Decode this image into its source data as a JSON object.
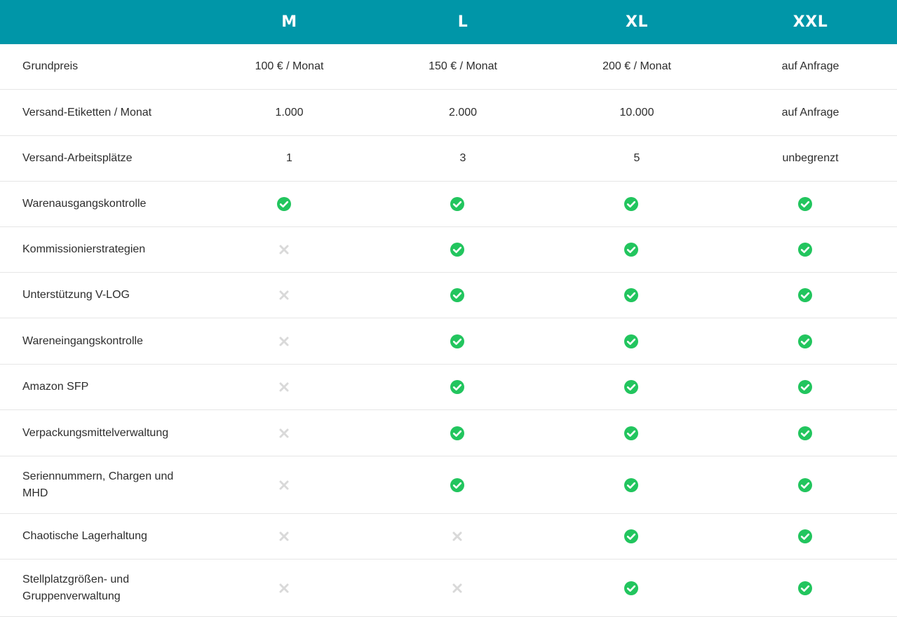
{
  "colors": {
    "header_bg": "#0096a8",
    "check": "#22c55e",
    "cross": "#d9d9d9"
  },
  "header": {
    "corner": "",
    "plans": [
      "M",
      "L",
      "XL",
      "XXL"
    ]
  },
  "rows": [
    {
      "label": "Grundpreis",
      "values": [
        "100 € / Monat",
        "150 € / Monat",
        "200 € / Monat",
        "auf Anfrage"
      ]
    },
    {
      "label": "Versand-Etiketten / Monat",
      "values": [
        "1.000",
        "2.000",
        "10.000",
        "auf Anfrage"
      ]
    },
    {
      "label": "Versand-Arbeitsplätze",
      "values": [
        "1",
        "3",
        "5",
        "unbegrenzt"
      ]
    },
    {
      "label": "Warenausgangskontrolle",
      "features": [
        "check-icon",
        "check-icon",
        "check-icon",
        "check-icon"
      ]
    },
    {
      "label": "Kommissionierstrategien",
      "features": [
        "cross-icon",
        "check-icon",
        "check-icon",
        "check-icon"
      ]
    },
    {
      "label": "Unterstützung V-LOG",
      "features": [
        "cross-icon",
        "check-icon",
        "check-icon",
        "check-icon"
      ]
    },
    {
      "label": "Wareneingangskontrolle",
      "features": [
        "cross-icon",
        "check-icon",
        "check-icon",
        "check-icon"
      ]
    },
    {
      "label": "Amazon SFP",
      "features": [
        "cross-icon",
        "check-icon",
        "check-icon",
        "check-icon"
      ]
    },
    {
      "label": "Verpackungsmittelverwaltung",
      "features": [
        "cross-icon",
        "check-icon",
        "check-icon",
        "check-icon"
      ]
    },
    {
      "label": "Seriennummern, Chargen und MHD",
      "features": [
        "cross-icon",
        "check-icon",
        "check-icon",
        "check-icon"
      ]
    },
    {
      "label": "Chaotische Lagerhaltung",
      "features": [
        "cross-icon",
        "cross-icon",
        "check-icon",
        "check-icon"
      ]
    },
    {
      "label": "Stellplatzgrößen- und Gruppenverwaltung",
      "features": [
        "cross-icon",
        "cross-icon",
        "check-icon",
        "check-icon"
      ]
    }
  ]
}
